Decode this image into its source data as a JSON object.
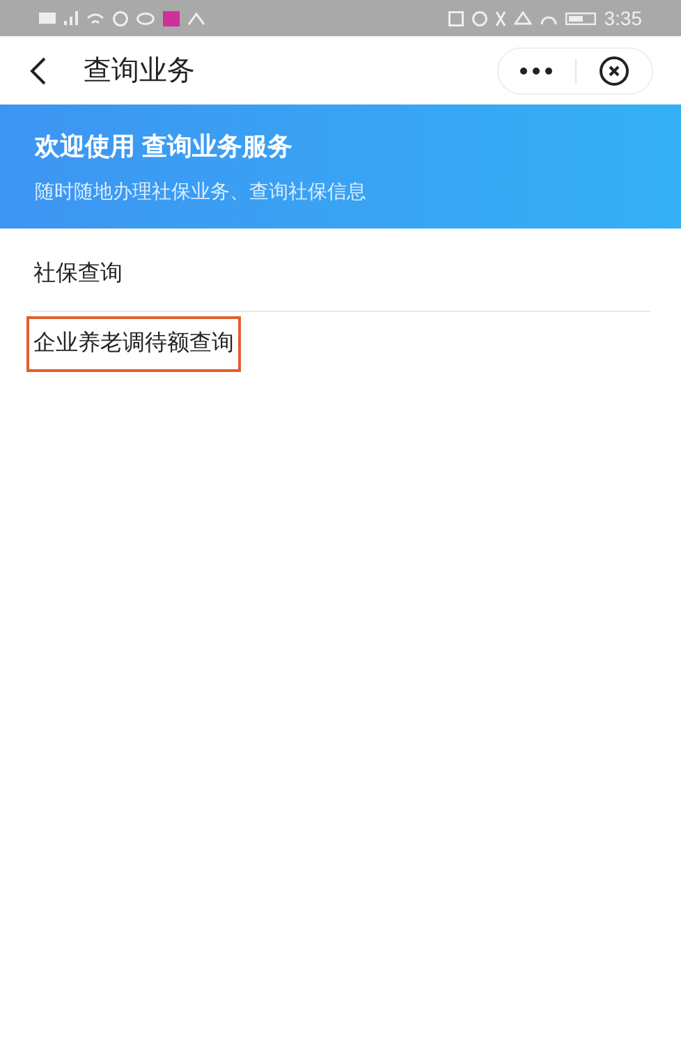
{
  "status_bar": {
    "time": "3:35"
  },
  "nav": {
    "title": "查询业务"
  },
  "banner": {
    "title": "欢迎使用 查询业务服务",
    "subtitle": "随时随地办理社保业务、查询社保信息"
  },
  "items": [
    {
      "label": "社保查询",
      "highlighted": false
    },
    {
      "label": "企业养老调待额查询",
      "highlighted": true
    }
  ]
}
